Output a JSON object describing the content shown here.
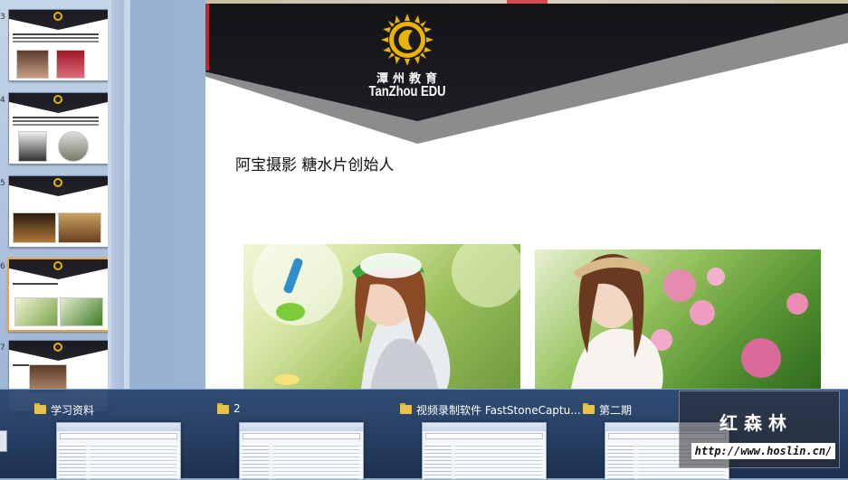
{
  "slide": {
    "logo_cn": "潭州教育",
    "logo_en": "TanZhou EDU",
    "title": "阿宝摄影   糖水片创始人",
    "colors": {
      "header_dark": "#1a1a1f",
      "header_grey": "#8c8c8f",
      "logo_gold": "#e8b400",
      "accent_red": "#c0262e"
    }
  },
  "thumbnails": [
    {
      "num": "3"
    },
    {
      "num": "4"
    },
    {
      "num": "5"
    },
    {
      "num": "6",
      "selected": true
    },
    {
      "num": "7"
    }
  ],
  "taskbar": {
    "items": [
      {
        "label": "学习资料",
        "icon": "folder-icon"
      },
      {
        "label": "2",
        "icon": "folder-icon"
      },
      {
        "label": "视频录制软件 FastStoneCaptu...",
        "icon": "folder-icon"
      },
      {
        "label": "第二期",
        "icon": "folder-icon"
      }
    ]
  },
  "watermark": {
    "name": "红森林",
    "url": "http://www.hoslin.cn/"
  }
}
